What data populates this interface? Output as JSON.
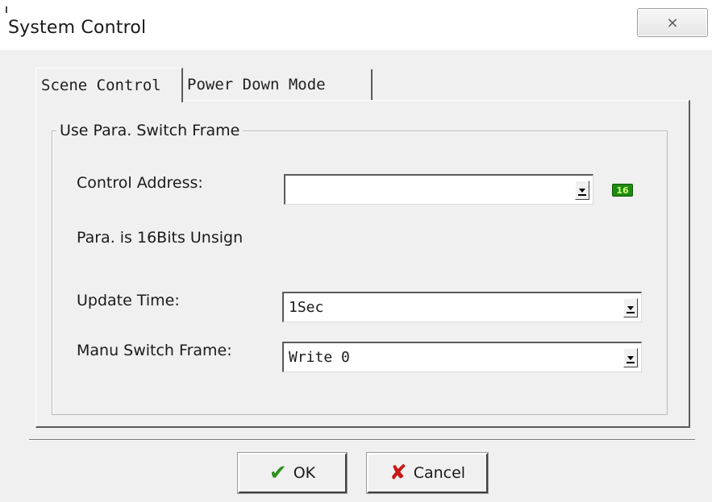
{
  "window": {
    "title": "System Control",
    "close_glyph": "⨯"
  },
  "tabs": [
    {
      "label": "Scene Control",
      "active": true
    },
    {
      "label": "Power Down Mode",
      "active": false
    }
  ],
  "group": {
    "title": "Use Para. Switch Frame",
    "control_address": {
      "label": "Control Address:",
      "value": "",
      "badge": "16"
    },
    "para_note": "Para. is 16Bits Unsign",
    "update_time": {
      "label": "Update Time:",
      "value": "1Sec"
    },
    "manu_switch_frame": {
      "label": "Manu Switch Frame:",
      "value": "Write 0"
    }
  },
  "buttons": {
    "ok_label": "OK",
    "cancel_label": "Cancel"
  },
  "colors": {
    "badge_bg": "#1f8a12",
    "ok_icon": "#2f8f1f",
    "cancel_icon": "#c81818"
  }
}
